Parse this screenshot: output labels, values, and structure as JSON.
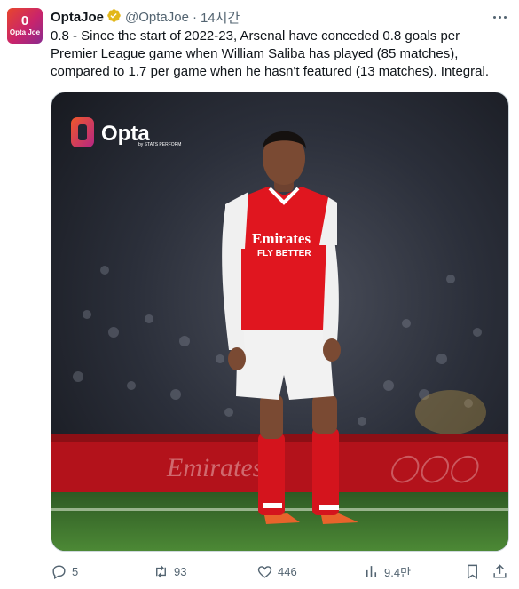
{
  "author": {
    "avatar_text": "Opta Joe",
    "name": "OptaJoe",
    "verified": true,
    "handle": "@OptaJoe",
    "separator": "·",
    "time": "14시간"
  },
  "tweet": {
    "text": "0.8 - Since the start of 2022-23, Arsenal have conceded 0.8 goals per Premier League game when William Saliba has played (85 matches), compared to 1.7 per game when he hasn't featured (13 matches). Integral."
  },
  "media": {
    "logo_text": "Opta",
    "logo_sub": "by STATS PERFORM",
    "shirt_sponsor_line1": "Emirates",
    "shirt_sponsor_line2": "FLY BETTER",
    "stand_text": "Emirates",
    "colors": {
      "kit_red": "#e0161f",
      "pitch": "#3a6b2b"
    }
  },
  "actions": {
    "replies": "5",
    "reposts": "93",
    "likes": "446",
    "views": "9.4만"
  },
  "colors": {
    "text": "#0f1419",
    "muted": "#536471",
    "verified": "#e2b719"
  }
}
